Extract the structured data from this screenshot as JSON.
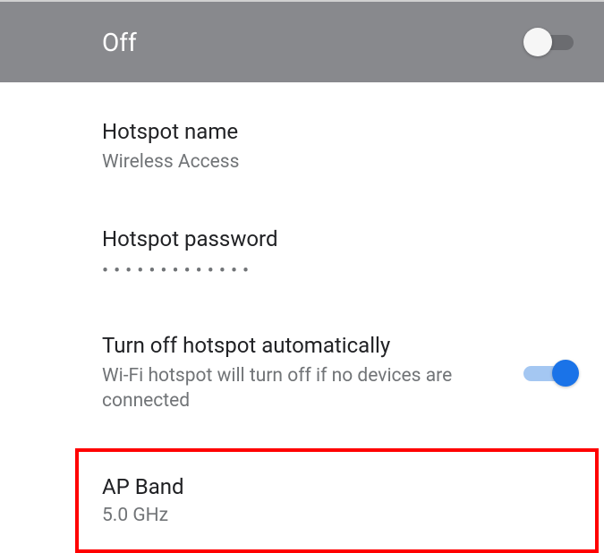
{
  "header": {
    "status_label": "Off",
    "toggle_on": false
  },
  "settings": {
    "hotspot_name": {
      "title": "Hotspot name",
      "value": "Wireless Access"
    },
    "hotspot_password": {
      "title": "Hotspot password",
      "masked_value": "•••••••••••••"
    },
    "auto_off": {
      "title": "Turn off hotspot automatically",
      "subtitle": "Wi-Fi hotspot will turn off if no devices are connected",
      "toggle_on": true
    },
    "ap_band": {
      "title": "AP Band",
      "value": "5.0 GHz"
    }
  },
  "colors": {
    "header_bg": "#88898d",
    "accent": "#1a73e8",
    "highlight_border": "#ff0000"
  }
}
